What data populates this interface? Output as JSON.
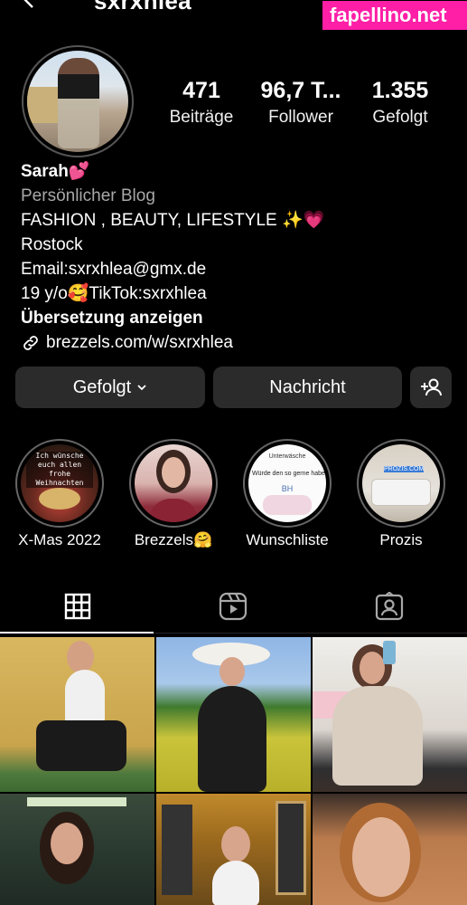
{
  "header": {
    "username": "sxrxhlea",
    "watermark": "fapellino.net"
  },
  "stats": [
    {
      "value": "471",
      "label": "Beiträge"
    },
    {
      "value": "96,7 T...",
      "label": "Follower"
    },
    {
      "value": "1.355",
      "label": "Gefolgt"
    }
  ],
  "bio": {
    "name": "Sarah💕",
    "category": "Persönlicher Blog",
    "lines": [
      "FASHION , BEAUTY, LIFESTYLE ✨💗",
      "Rostock",
      "Email:sxrxhlea@gmx.de",
      "19 y/o🥰TikTok:sxrxhlea"
    ],
    "translate": "Übersetzung anzeigen",
    "link": "brezzels.com/w/sxrxhlea"
  },
  "actions": {
    "follow": "Gefolgt",
    "message": "Nachricht",
    "add_person_icon": "add-person-icon"
  },
  "highlights": [
    {
      "label": "X-Mas 2022",
      "overlay": "Ich wünsche euch allen frohe Weihnachten"
    },
    {
      "label": "Brezzels🤗",
      "overlay": ""
    },
    {
      "label": "Wunschliste",
      "overlay": "Unterwäsche",
      "overlay2": "Würde den so gerne haben 😊",
      "overlay3": "BH"
    },
    {
      "label": "Prozis",
      "overlay": "PROZIS.COM"
    }
  ],
  "tabs": [
    {
      "icon": "grid-icon"
    },
    {
      "icon": "reels-icon"
    },
    {
      "icon": "tagged-icon"
    }
  ],
  "colors": {
    "background": "#000000",
    "button": "#2b2b2b",
    "secondary_text": "#a8a8a8",
    "watermark": "#ff1fa7"
  }
}
